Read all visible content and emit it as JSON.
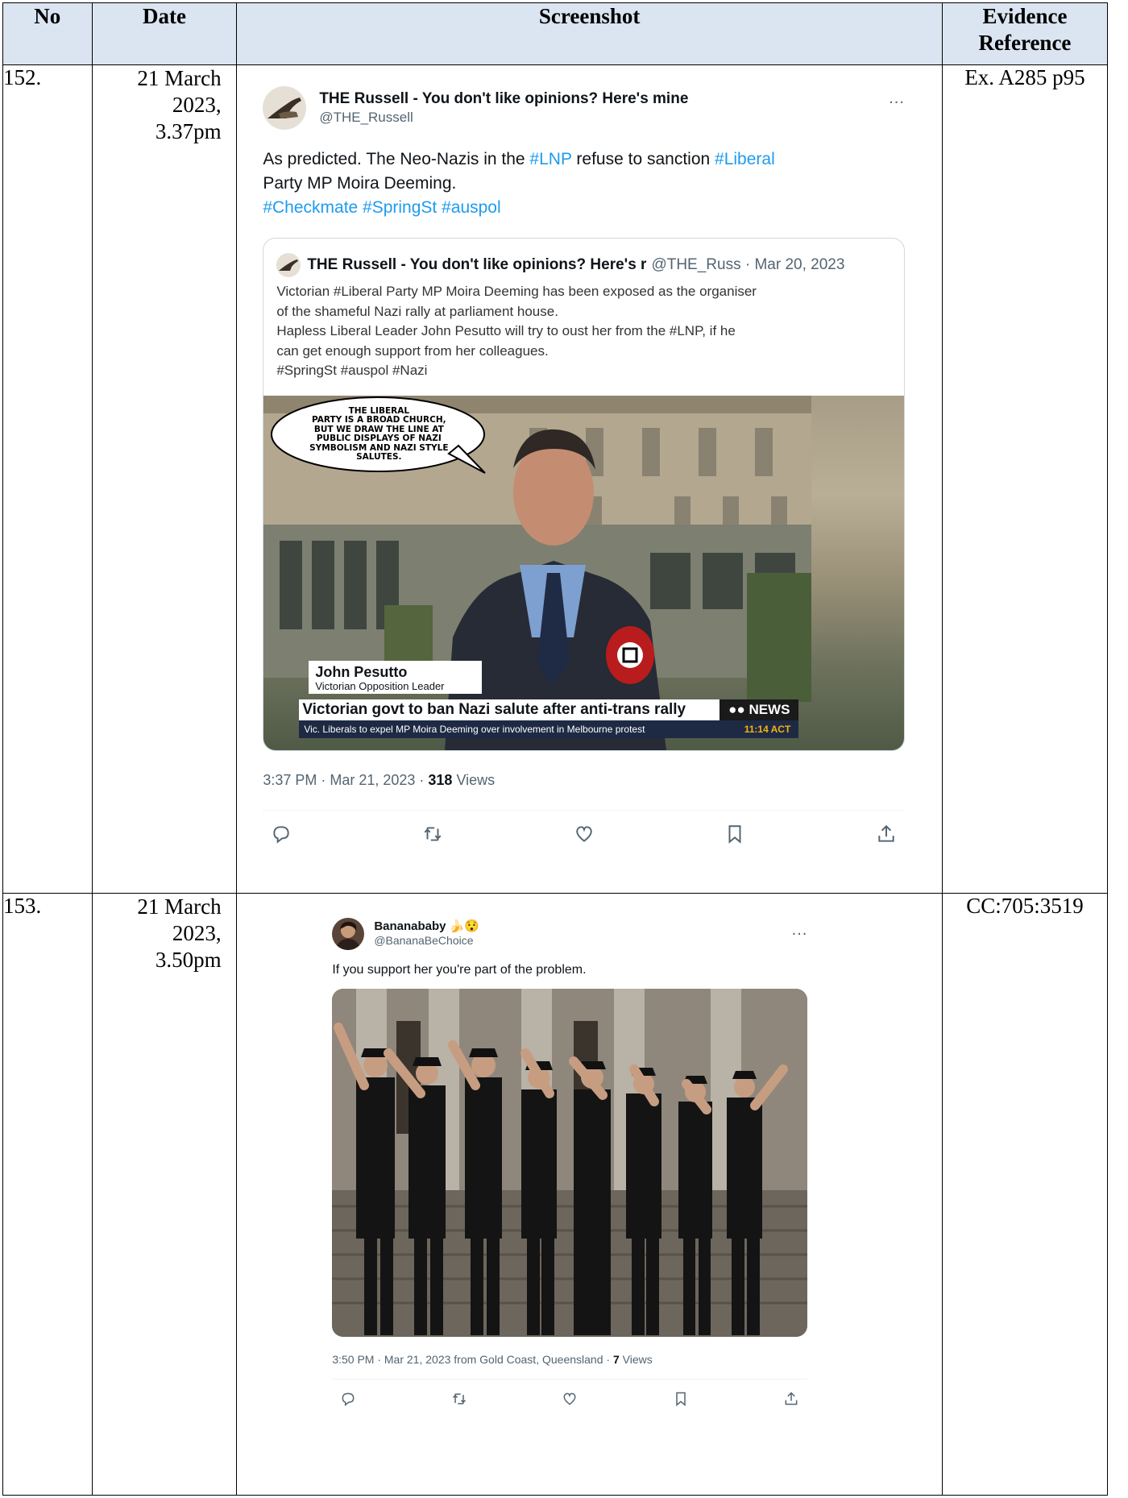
{
  "table": {
    "headers": {
      "no": "No",
      "date": "Date",
      "screenshot": "Screenshot",
      "reference_line1": "Evidence",
      "reference_line2": "Reference"
    },
    "rows": [
      {
        "no": "152.",
        "date_lines": [
          "21 March",
          "2023,",
          "3.37pm"
        ],
        "reference": "Ex. A285 p95",
        "tweet": {
          "name": "THE Russell - You don't like opinions? Here's mine",
          "handle": "@THE_Russell",
          "more": "...",
          "text_parts": [
            "As predicted. The Neo-Nazis in the ",
            "#LNP",
            " refuse to sanction ",
            "#Liberal",
            " Party MP Moira Deeming.",
            "#Checkmate #SpringSt #auspol"
          ],
          "quote": {
            "name": "THE Russell - You don't like opinions? Here's r",
            "handle_date": "@THE_Russ · Mar 20, 2023",
            "lines": [
              "Victorian #Liberal Party MP Moira Deeming has been exposed as the organiser",
              "of the shameful Nazi rally at parliament house.",
              "Hapless Liberal Leader John Pesutto will try to oust her from the #LNP, if he",
              "can get enough support from her colleagues.",
              "#SpringSt #auspol #Nazi"
            ],
            "image": {
              "bubble_lines": [
                "THE LIBERAL",
                "PARTY IS A BROAD CHURCH,",
                "BUT WE DRAW THE LINE AT",
                "PUBLIC DISPLAYS OF NAZI",
                "SYMBOLISM AND NAZI STYLE",
                "SALUTES."
              ],
              "lower_third_name": "John Pesutto",
              "lower_third_title": "Victorian Opposition Leader",
              "headline": "Victorian govt to ban Nazi salute after anti-trans rally",
              "channel": "NEWS",
              "ticker": "Vic. Liberals to expel MP Moira Deeming over involvement in Melbourne protest",
              "ticker_time": "11:14 ACT"
            }
          },
          "time": "3:37 PM · Mar 21, 2023 · ",
          "views_count": "318",
          "views_label": " Views",
          "icons": [
            "reply-icon",
            "retweet-icon",
            "like-icon",
            "bookmark-icon",
            "share-icon"
          ]
        }
      },
      {
        "no": "153.",
        "date_lines": [
          "21 March",
          "2023,",
          "3.50pm"
        ],
        "reference": "CC:705:3519",
        "tweet": {
          "name": "Bananababy 🍌😯",
          "handle": "@BananaBeChoice",
          "more": "...",
          "text": "If you support her you're part of the problem.",
          "time": "3:50 PM · Mar 21, 2023 from Gold Coast, Queensland · ",
          "views_count": "7",
          "views_label": " Views",
          "icons": [
            "reply-icon",
            "retweet-icon",
            "like-icon",
            "bookmark-icon",
            "share-icon"
          ]
        }
      }
    ]
  },
  "colors": {
    "header_bg": "#dbe5f1",
    "link": "#1d9bf0",
    "muted": "#536471"
  }
}
